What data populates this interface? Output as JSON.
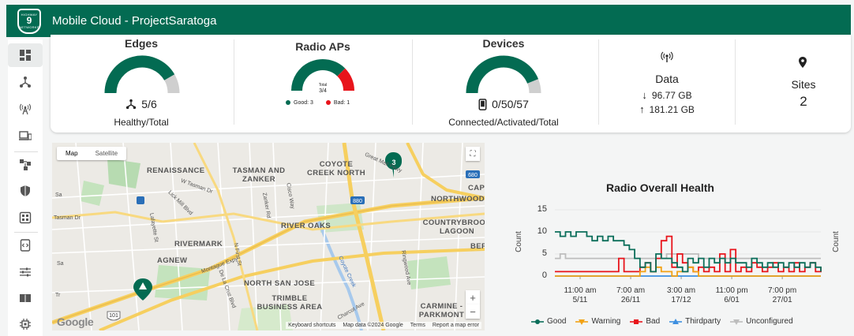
{
  "header": {
    "title": "Mobile Cloud - ProjectSaratoga",
    "logo": {
      "top": "HIGHWAY",
      "number": "9",
      "bottom": "NETWORKS"
    }
  },
  "sidebar": {
    "items": [
      "dashboard",
      "topology",
      "radio-aps",
      "devices",
      "edges",
      "security",
      "apps",
      "integrations",
      "settings",
      "docs",
      "chip"
    ]
  },
  "summary": {
    "edges": {
      "title": "Edges",
      "value": "5/6",
      "caption": "Healthy/Total",
      "healthy": 5,
      "total": 6
    },
    "radio_aps": {
      "title": "Radio APs",
      "center_label": "Total",
      "center_value": "3/4",
      "good_label": "Good: 3",
      "bad_label": "Bad: 1",
      "good": 3,
      "bad": 1
    },
    "devices": {
      "title": "Devices",
      "value": "0/50/57",
      "caption": "Connected/Activated/Total",
      "connected": 0,
      "activated": 50,
      "total": 57
    },
    "data": {
      "title": "Data",
      "down": "96.77 GB",
      "up": "181.21 GB"
    },
    "sites": {
      "title": "Sites",
      "value": "2"
    },
    "colors": {
      "primary": "#036b52",
      "bad": "#e8141b",
      "track": "#cfcfcf"
    }
  },
  "map": {
    "tabs": [
      "Map",
      "Satellite"
    ],
    "cluster_count": "3",
    "labels": [
      "RENAISSANCE",
      "TASMAN AND ZANKER",
      "COYOTE CREEK NORTH",
      "NORTHWOOD",
      "CAP",
      "RIVER OAKS",
      "COUNTRYBROOK LAGOON",
      "RIVERMARK",
      "AGNEW",
      "NORTH SAN JOSE",
      "TRIMBLE BUSINESS AREA",
      "CARMINE - PARKMONT",
      "BER"
    ],
    "streets": [
      "W Tasman Dr",
      "Lick Mill Blvd",
      "Lafayette St",
      "Zanker Rd",
      "Cisco Way",
      "N First St",
      "Montague Expy",
      "De La Cruz Blvd",
      "Coyote Creek",
      "Charcot Ave",
      "Ringwood Ave",
      "Great Mall Pkwy",
      "Sa",
      "Tasman Dr",
      "Sa",
      "Tr"
    ],
    "shields": [
      "880",
      "680",
      "101"
    ],
    "footer": [
      "Keyboard shortcuts",
      "Map data ©2024 Google",
      "Terms",
      "Report a map error"
    ],
    "google": "Google",
    "zoom_in": "+",
    "zoom_out": "−"
  },
  "chart_data": {
    "type": "line",
    "title": "Radio Overall Health",
    "ylabel": "Count",
    "ylabel_right": "Count",
    "ylim": [
      0,
      15
    ],
    "yticks": [
      "15",
      "10",
      "5",
      "0"
    ],
    "xticks": [
      [
        "11:00 am",
        "5/11"
      ],
      [
        "7:00 am",
        "26/11"
      ],
      [
        "3:00 am",
        "17/12"
      ],
      [
        "11:00 pm",
        "6/01"
      ],
      [
        "7:00 pm",
        "27/01"
      ]
    ],
    "x": [
      0,
      2,
      4,
      6,
      8,
      10,
      12,
      14,
      16,
      18,
      20,
      22,
      24,
      26,
      28,
      30,
      32,
      34,
      36,
      38,
      40,
      42,
      44,
      46,
      48,
      50,
      52,
      54,
      56,
      58,
      60,
      62,
      64,
      66,
      68,
      70,
      72,
      74,
      76,
      78,
      80,
      82,
      84,
      86,
      88,
      90,
      92,
      94,
      96,
      98,
      100
    ],
    "series": [
      {
        "name": "Good",
        "color": "#0b6e5a",
        "values": [
          10,
          9,
          10,
          9,
          10,
          10,
          9,
          8,
          9,
          8,
          9,
          8,
          8,
          7,
          6,
          4,
          2,
          3,
          1,
          5,
          4,
          4,
          3,
          2,
          1,
          4,
          3,
          4,
          2,
          4,
          3,
          4,
          3,
          4,
          3,
          3,
          2,
          4,
          3,
          2,
          3,
          2,
          3,
          2,
          3,
          2,
          3,
          2,
          3,
          2,
          1
        ]
      },
      {
        "name": "Warning",
        "color": "#f2a215",
        "values": [
          0,
          0,
          0,
          0,
          0,
          0,
          0,
          0,
          0,
          0,
          0,
          0,
          0,
          0,
          0,
          0,
          1,
          2,
          1,
          2,
          1,
          1,
          0,
          1,
          1,
          2,
          1,
          0,
          0,
          0,
          0,
          0,
          0,
          0,
          0,
          0,
          0,
          0,
          0,
          0,
          0,
          0,
          0,
          0,
          0,
          0,
          0,
          0,
          0,
          0,
          0
        ]
      },
      {
        "name": "Bad",
        "color": "#e8141b",
        "values": [
          1,
          1,
          1,
          1,
          1,
          1,
          1,
          1,
          1,
          1,
          1,
          1,
          4,
          1,
          1,
          1,
          2,
          3,
          1,
          4,
          8,
          9,
          2,
          5,
          3,
          2,
          1,
          2,
          1,
          2,
          1,
          5,
          1,
          6,
          1,
          2,
          1,
          3,
          2,
          1,
          2,
          3,
          1,
          2,
          1,
          3,
          1,
          2,
          3,
          1,
          2
        ]
      },
      {
        "name": "Thirdparty",
        "color": "#3d8fe0",
        "values": [
          0,
          0,
          0,
          0,
          0,
          0,
          0,
          0,
          0,
          0,
          0,
          0,
          0,
          0,
          0,
          0,
          0,
          0,
          0,
          0,
          0,
          0,
          0,
          0,
          0,
          0,
          0,
          0,
          0,
          0,
          0,
          0,
          0,
          0,
          0,
          0,
          0,
          0,
          0,
          0,
          0,
          0,
          0,
          0,
          0,
          0,
          0,
          0,
          0,
          0,
          0
        ]
      },
      {
        "name": "Unconfigured",
        "color": "#bdbdbd",
        "values": [
          4,
          5,
          4,
          4,
          4,
          4,
          4,
          4,
          4,
          4,
          4,
          4,
          4,
          4,
          4,
          4,
          4,
          4,
          4,
          4,
          4,
          5,
          5,
          5,
          5,
          5,
          5,
          4,
          4,
          4,
          4,
          4,
          4,
          4,
          4,
          4,
          4,
          4,
          4,
          4,
          4,
          4,
          4,
          4,
          4,
          4,
          4,
          4,
          4,
          4,
          4
        ]
      }
    ],
    "grid": true,
    "legend_position": "bottom"
  }
}
